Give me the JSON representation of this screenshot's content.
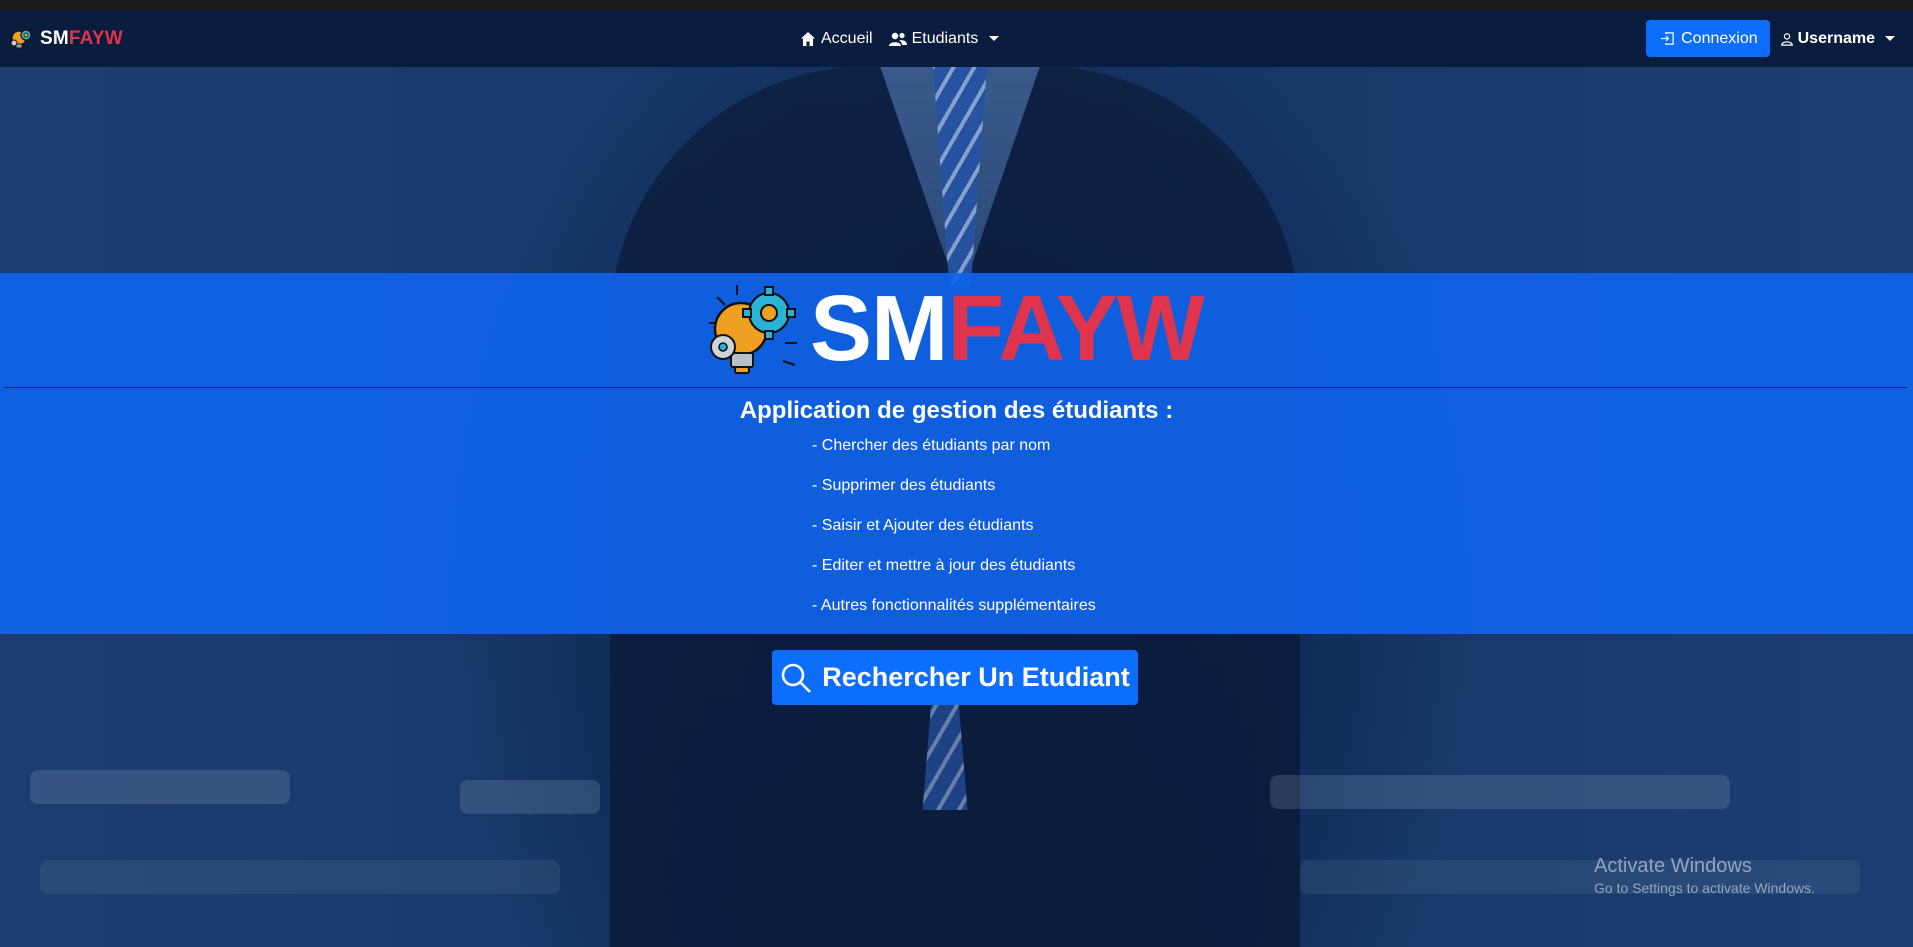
{
  "brand": {
    "text_a": "SM",
    "text_b": "FAYW",
    "accent_color": "#e0344d"
  },
  "nav": {
    "home_label": "Accueil",
    "students_label": "Etudiants",
    "login_label": "Connexion",
    "username_label": "Username"
  },
  "hero": {
    "title_a": "SM",
    "title_b": "FAYW",
    "subtitle": "Application de gestion des étudiants :",
    "features": [
      "- Chercher des étudiants par nom",
      "- Supprimer des étudiants",
      "- Saisir et Ajouter des étudiants",
      "- Editer et mettre à jour des étudiants",
      "- Autres fonctionnalités supplémentaires"
    ]
  },
  "search_button": {
    "label": "Rechercher Un Etudiant",
    "color": "#0d6efd"
  },
  "watermark": {
    "line1": "Activate Windows",
    "line2": "Go to Settings to activate Windows."
  }
}
